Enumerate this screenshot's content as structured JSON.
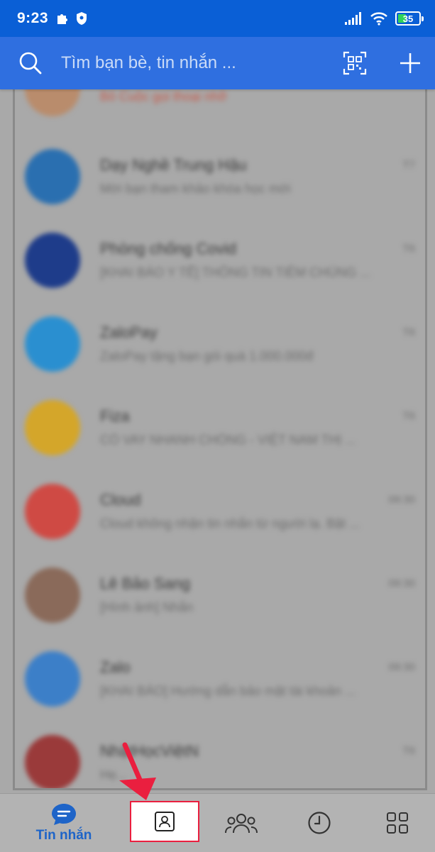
{
  "status_bar": {
    "time": "9:23",
    "battery_level": "35"
  },
  "header": {
    "search_placeholder": "Tìm bạn bè, tin nhắn ..."
  },
  "chats": [
    {
      "name": "",
      "preview": "Bỏ Cuộc gọi thoại nhỡ",
      "time": "",
      "avatar_color": "#b98c6c"
    },
    {
      "name": "Dạy Nghề Trung Hậu",
      "preview": "Mời bạn tham khảo khóa học mới",
      "time": "T7",
      "avatar_color": "#2a6fb0"
    },
    {
      "name": "Phòng chống Covid",
      "preview": "[KHAI BÁO Y TẾ] THÔNG TIN TIÊM CHỦNG ...",
      "time": "T6",
      "avatar_color": "#1e3c8a"
    },
    {
      "name": "ZaloPay",
      "preview": "ZaloPay tặng bạn gói quà 1.000.000đ",
      "time": "T6",
      "avatar_color": "#2a8fd0"
    },
    {
      "name": "Fiza",
      "preview": "CÓ VAY NHANH CHÓNG - VIỆT NAM THỊ ...",
      "time": "T6",
      "avatar_color": "#d4a62a"
    },
    {
      "name": "Cloud",
      "preview": "Cloud không nhận tin nhắn từ người lạ. Bật ...",
      "time": "09:30",
      "avatar_color": "#cf4a44"
    },
    {
      "name": "Lê Bảo Sang",
      "preview": "[Hình ảnh] Nhắn",
      "time": "09:30",
      "avatar_color": "#8a6a5a"
    },
    {
      "name": "Zalo",
      "preview": "[KHAI BÁO] Hướng dẫn bảo mật tài khoản ...",
      "time": "09:30",
      "avatar_color": "#3c7fc8"
    },
    {
      "name": "NhậtHọcViệtN",
      "preview": "Hẹ...",
      "time": "T6",
      "avatar_color": "#9a3a3a"
    }
  ],
  "bottom_nav": {
    "messages_label": "Tin nhắn"
  },
  "colors": {
    "header": "#2f6fe0",
    "status_bar": "#0a5fd6",
    "accent": "#1e64c8",
    "highlight": "#ea1f3f"
  }
}
